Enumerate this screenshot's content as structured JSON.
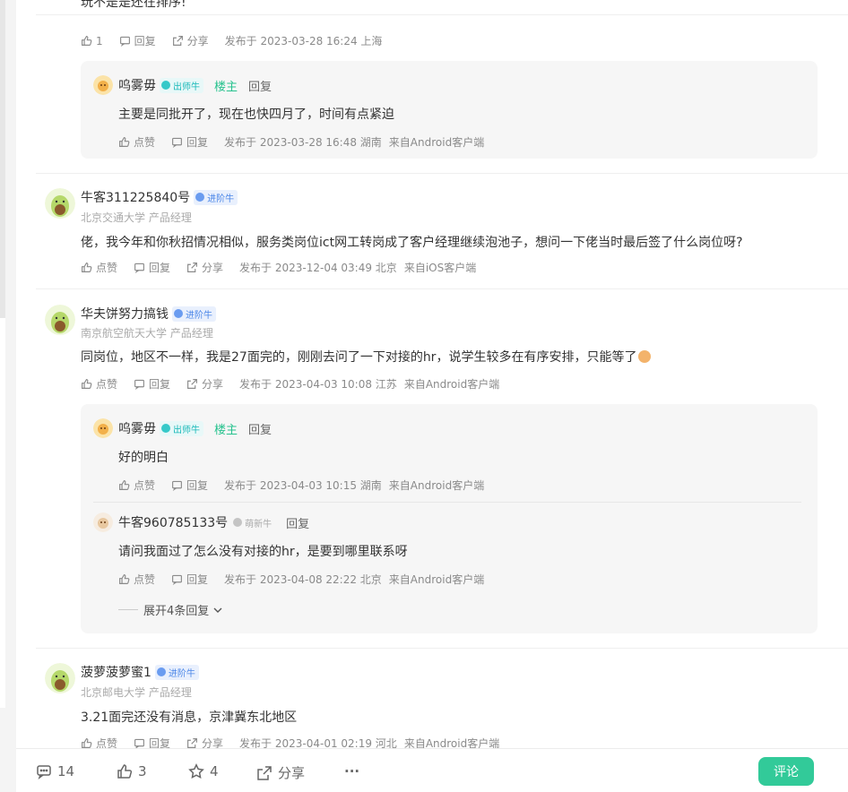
{
  "top_cut": {
    "text": "玩不是是还在排序!",
    "likes": "1",
    "reply_label": "回复",
    "share_label": "分享",
    "meta": "发布于 2023-03-28 16:24 上海"
  },
  "thread1_reply": {
    "user": "呜雾毋",
    "badge": "出师牛",
    "louzhu": "楼主",
    "replyto": "回复",
    "text": "主要是同批开了，现在也快四月了，时间有点紧迫",
    "like_label": "点赞",
    "reply_label": "回复",
    "meta": "发布于 2023-03-28 16:48 湖南",
    "client": "来自Android客户端"
  },
  "comment2": {
    "user": "牛客311225840号",
    "badge": "进阶牛",
    "school": "北京交通大学 产品经理",
    "text": "佬，我今年和你秋招情况相似，服务类岗位ict网工转岗成了客户经理继续泡池子，想问一下佬当时最后签了什么岗位呀?",
    "like_label": "点赞",
    "reply_label": "回复",
    "share_label": "分享",
    "meta": "发布于 2023-12-04 03:49 北京",
    "client": "来自iOS客户端"
  },
  "comment3": {
    "user": "华夫饼努力搞钱",
    "badge": "进阶牛",
    "school": "南京航空航天大学 产品经理",
    "text": "同岗位，地区不一样，我是27面完的，刚刚去问了一下对接的hr，说学生较多在有序安排，只能等了",
    "like_label": "点赞",
    "reply_label": "回复",
    "share_label": "分享",
    "meta": "发布于 2023-04-03 10:08 江苏",
    "client": "来自Android客户端",
    "replies": [
      {
        "user": "呜雾毋",
        "badge": "出师牛",
        "louzhu": "楼主",
        "replyto": "回复",
        "text": "好的明白",
        "like_label": "点赞",
        "reply_label": "回复",
        "meta": "发布于 2023-04-03 10:15 湖南",
        "client": "来自Android客户端"
      },
      {
        "user": "牛客960785133号",
        "badge": "萌新牛",
        "replyto": "回复",
        "text": "请问我面过了怎么没有对接的hr，是要到哪里联系呀",
        "like_label": "点赞",
        "reply_label": "回复",
        "meta": "发布于 2023-04-08 22:22 北京",
        "client": "来自Android客户端"
      }
    ],
    "expand_label": "展开4条回复"
  },
  "comment4": {
    "user": "菠萝菠萝蜜1",
    "badge": "进阶牛",
    "school": "北京邮电大学 产品经理",
    "text": "3.21面完还没有消息，京津冀东北地区",
    "like_label": "点赞",
    "reply_label": "回复",
    "share_label": "分享",
    "meta": "发布于 2023-04-01 02:19 河北",
    "client": "来自Android客户端"
  },
  "bottom_bar": {
    "comments": "14",
    "likes": "3",
    "stars": "4",
    "share_label": "分享",
    "more": "···",
    "comment_button": "评论"
  },
  "colors": {
    "accent_green": "#32ca99",
    "louzhu_green": "#27c28e",
    "badge_teal": "#18b8b8",
    "badge_blue": "#4a86e8"
  }
}
